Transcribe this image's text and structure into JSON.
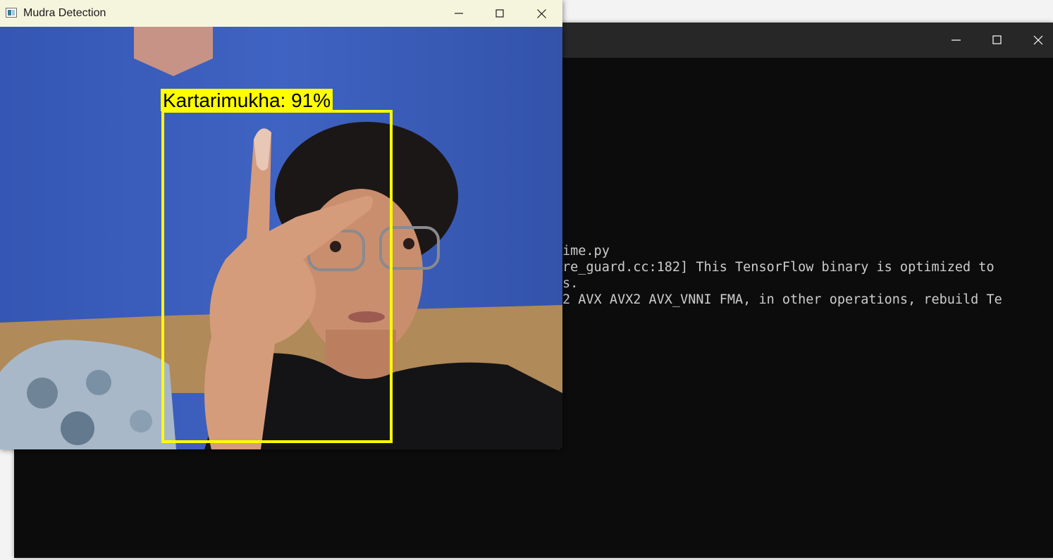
{
  "terminal": {
    "lines": [
      "ime.py",
      "re_guard.cc:182] This TensorFlow binary is optimized to",
      "s.",
      "2 AVX AVX2 AVX_VNNI FMA, in other operations, rebuild Te"
    ]
  },
  "mudra_window": {
    "title": "Mudra Detection",
    "detection": {
      "label": "Kartarimukha: 91%",
      "box_color": "#ffff00"
    }
  },
  "icons": {
    "minimize": "minimize-icon",
    "maximize": "maximize-icon",
    "close": "close-icon"
  }
}
